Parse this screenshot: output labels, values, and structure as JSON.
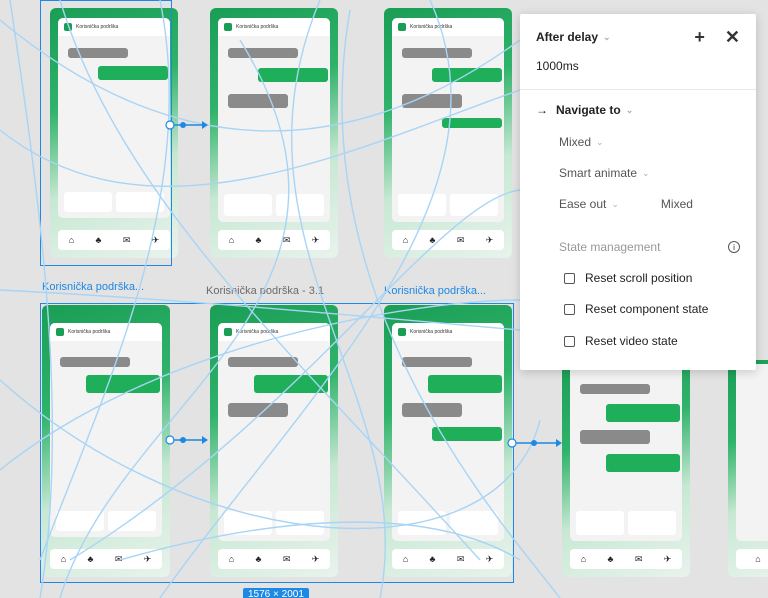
{
  "canvas": {
    "frames": [
      {
        "label": "Korisnička podrška...",
        "selected": true
      },
      {
        "label": "Korisnička podrška - 3.1",
        "selected": false
      },
      {
        "label": "Korisnička podrška...",
        "selected": true
      }
    ],
    "header_text": "Korisnička podrška",
    "selection_dimensions": "1576 × 2001"
  },
  "panel": {
    "trigger": "After delay",
    "delay": "1000ms",
    "action": "Navigate to",
    "destination": "Mixed",
    "animation": "Smart animate",
    "easing": "Ease out",
    "duration": "Mixed",
    "state_management_title": "State management",
    "options": [
      {
        "label": "Reset scroll position",
        "checked": false
      },
      {
        "label": "Reset component state",
        "checked": false
      },
      {
        "label": "Reset video state",
        "checked": false
      }
    ]
  }
}
